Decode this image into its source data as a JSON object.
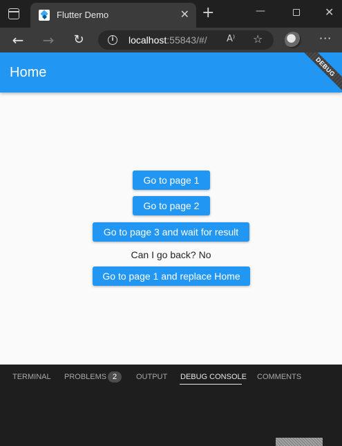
{
  "browser": {
    "tab_title": "Flutter Demo",
    "tab_close": "✕",
    "new_tab": "+",
    "url_host": "localhost",
    "url_path": ":55843/#/",
    "read_aloud": "A⁾",
    "more": "···"
  },
  "app": {
    "title": "Home",
    "debug_banner": "DEBUG",
    "buttons": {
      "page1": "Go to page 1",
      "page2": "Go to page 2",
      "page3_wait": "Go to page 3 and wait for result",
      "page1_replace": "Go to page 1 and replace Home"
    },
    "can_go_back": "Can I go back? No",
    "primary_color": "#2196f3"
  },
  "panel": {
    "tabs": {
      "terminal": "TERMINAL",
      "problems": "PROBLEMS",
      "problems_count": "2",
      "output": "OUTPUT",
      "debug_console": "DEBUG CONSOLE",
      "comments": "COMMENTS"
    }
  }
}
